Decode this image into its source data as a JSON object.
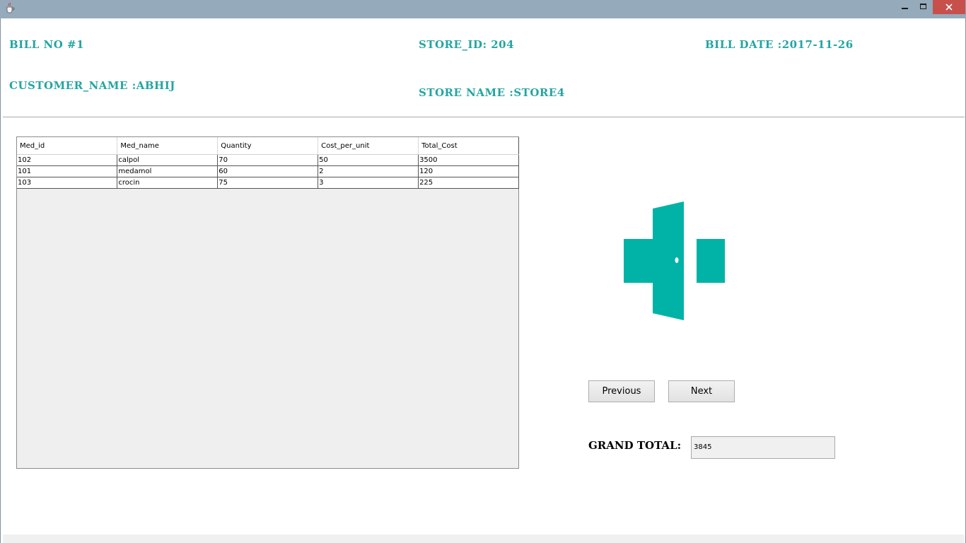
{
  "window": {
    "app_icon": "java-coffee-icon",
    "minimize_icon": "minimize-icon",
    "maximize_icon": "maximize-icon",
    "close_icon": "close-icon"
  },
  "header": {
    "bill_no": "BILL NO #1",
    "store_id": "STORE_ID: 204",
    "bill_date": "BILL DATE :2017-11-26",
    "customer_name": "CUSTOMER_NAME :ABHIJ",
    "store_name": "STORE NAME :STORE4"
  },
  "table": {
    "columns": [
      "Med_id",
      "Med_name",
      "Quantity",
      "Cost_per_unit",
      "Total_Cost"
    ],
    "rows": [
      [
        "102",
        "calpol",
        "70",
        "50",
        "3500"
      ],
      [
        "101",
        "medamol",
        "60",
        "2",
        "120"
      ],
      [
        "103",
        "crocin",
        "75",
        "3",
        "225"
      ]
    ]
  },
  "logo": {
    "icon": "medical-cross-door-icon",
    "color": "#00b3a6"
  },
  "buttons": {
    "previous": "Previous",
    "next": "Next"
  },
  "grand_total": {
    "label": "GRAND TOTAL:",
    "value": "3845"
  },
  "colors": {
    "header_text": "#23a5a2",
    "titlebar": "#95aabb",
    "close_button": "#c7504b"
  }
}
